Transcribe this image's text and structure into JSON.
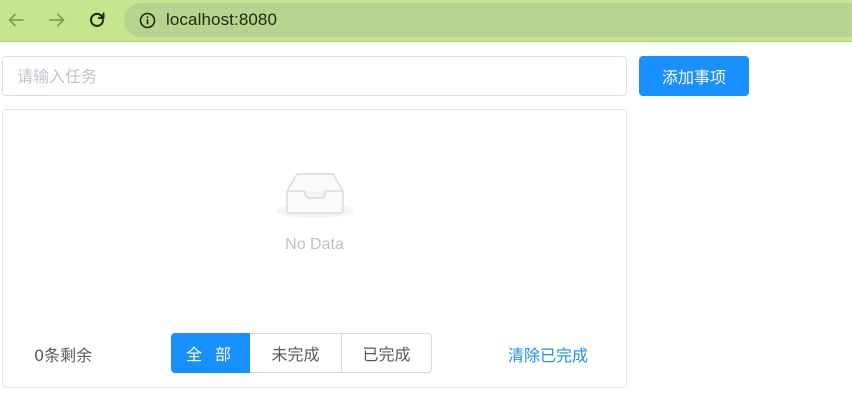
{
  "browser": {
    "url": "localhost:8080",
    "icons": {
      "back": "arrow-left-icon",
      "forward": "arrow-right-icon",
      "reload": "reload-icon",
      "info": "info-icon"
    }
  },
  "app": {
    "input_placeholder": "请输入任务",
    "add_button_label": "添加事项",
    "empty_text": "No Data",
    "remaining_text": "0条剩余",
    "filters": [
      {
        "label": "全 部",
        "active": true
      },
      {
        "label": "未完成",
        "active": false
      },
      {
        "label": "已完成",
        "active": false
      }
    ],
    "clear_completed_label": "清除已完成"
  },
  "colors": {
    "browser_bar": "#c5e58f",
    "address_bar": "#b6d38f",
    "primary": "#1890ff",
    "muted_text": "#bfbfbf"
  }
}
